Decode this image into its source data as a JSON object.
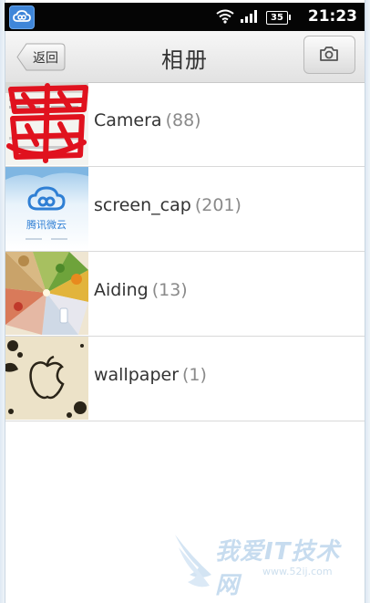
{
  "status_bar": {
    "app_icon": "weiyun-cloud-icon",
    "wifi_icon": "wifi-icon",
    "signal_icon": "signal-icon",
    "battery_level": "35",
    "time": "21:23"
  },
  "header": {
    "back_label": "返回",
    "title": "相册",
    "camera_icon": "camera-icon"
  },
  "albums": [
    {
      "name": "Camera",
      "count": "(88)"
    },
    {
      "name": "screen_cap",
      "count": "(201)"
    },
    {
      "name": "Aiding",
      "count": "(13)"
    },
    {
      "name": "wallpaper",
      "count": "(1)"
    }
  ],
  "thumbnails": {
    "screen_cap_brand": "腾讯微云"
  },
  "watermark": {
    "text": "我爱IT技术网",
    "url": "www.52ij.com"
  },
  "colors": {
    "status_bg": "#050505",
    "accent_blue": "#3f86d9",
    "count_gray": "#8a8a8a",
    "scribble_red": "#e0121e"
  }
}
